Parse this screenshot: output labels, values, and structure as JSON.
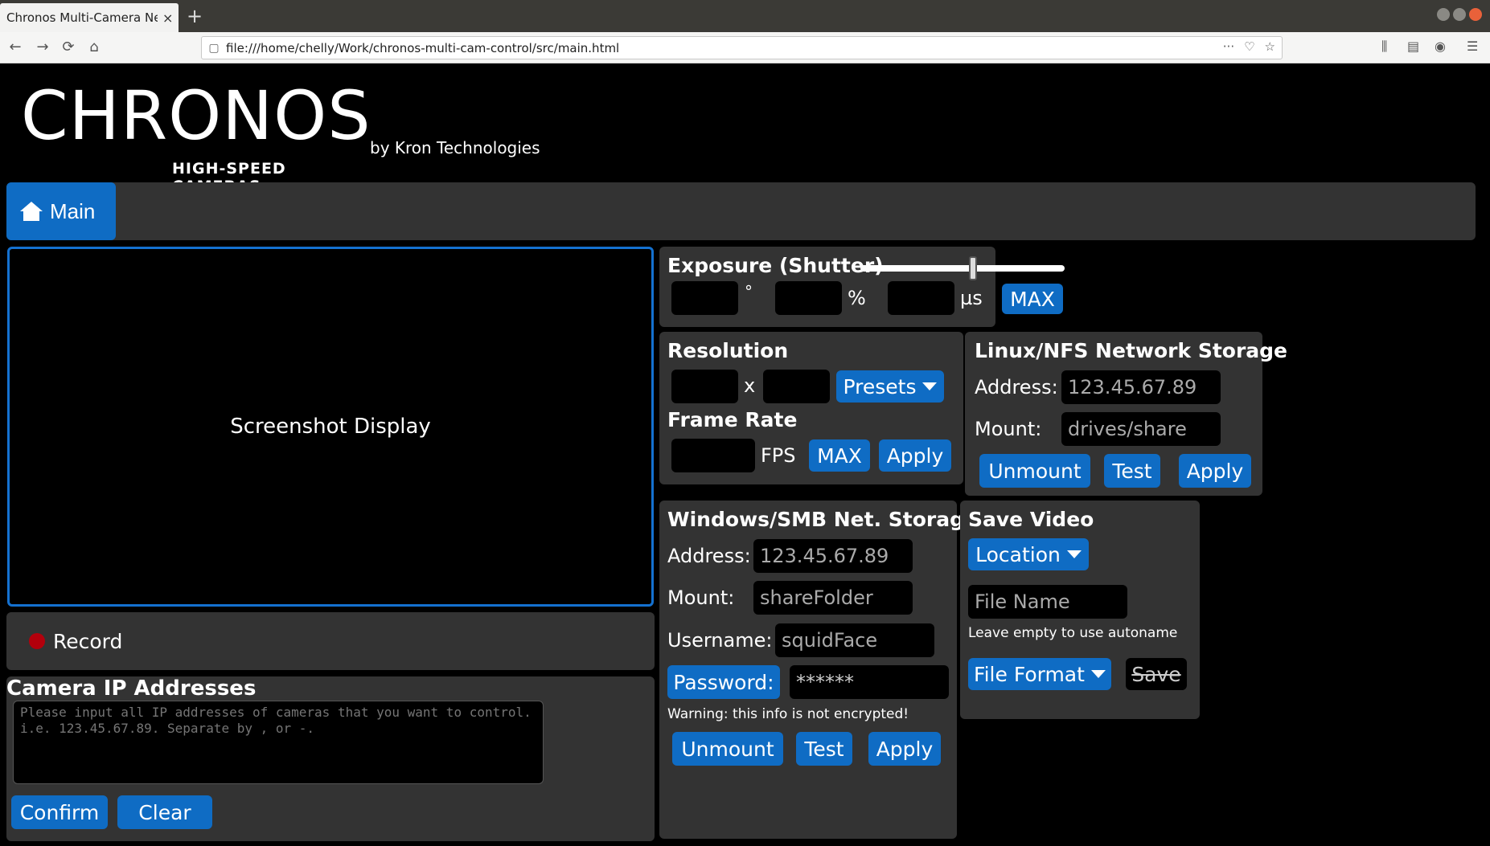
{
  "browser": {
    "tab_title": "Chronos Multi-Camera Netw",
    "tab_close": "×",
    "new_tab": "+",
    "url": "file:///home/chelly/Work/chronos-multi-cam-control/src/main.html",
    "url_actions": "···"
  },
  "header": {
    "logo_word": "CHRONOS",
    "logo_sub": "HIGH-SPEED CAMERAS",
    "byline": "by Kron Technologies"
  },
  "nav": {
    "main_tab": "Main"
  },
  "screenshot": {
    "label": "Screenshot Display"
  },
  "record": {
    "label": "Record"
  },
  "ip": {
    "title": "Camera IP Addresses",
    "placeholder": "Please input all IP addresses of cameras that you want to control. i.e. 123.45.67.89. Separate by , or -.",
    "confirm": "Confirm",
    "clear": "Clear"
  },
  "exposure": {
    "title": "Exposure (Shutter)",
    "slider_level": 0.55,
    "unit_degree": "°",
    "unit_percent": "%",
    "unit_us": "µs",
    "max": "MAX"
  },
  "resolution": {
    "title": "Resolution",
    "x": "x",
    "presets": "Presets",
    "fr_title": "Frame Rate",
    "fps": "FPS",
    "max": "MAX",
    "apply": "Apply"
  },
  "nfs": {
    "title": "Linux/NFS Network Storage",
    "address_label": "Address:",
    "address_placeholder": "123.45.67.89",
    "mount_label": "Mount:",
    "mount_placeholder": "drives/share",
    "unmount": "Unmount",
    "test": "Test",
    "apply": "Apply"
  },
  "smb": {
    "title": "Windows/SMB Net. Storage",
    "address_label": "Address:",
    "address_placeholder": "123.45.67.89",
    "mount_label": "Mount:",
    "mount_placeholder": "shareFolder",
    "username_label": "Username:",
    "username_placeholder": "squidFace",
    "password_button": "Password:",
    "password_value": "******",
    "warning": "Warning: this info is not encrypted!",
    "unmount": "Unmount",
    "test": "Test",
    "apply": "Apply"
  },
  "save": {
    "title": "Save Video",
    "location": "Location",
    "filename_placeholder": "File Name",
    "hint": "Leave empty to use autoname",
    "file_format": "File Format",
    "save": "Save"
  },
  "colors": {
    "accent": "#0f6cc4",
    "panel": "#333333",
    "record": "#b3000c"
  }
}
